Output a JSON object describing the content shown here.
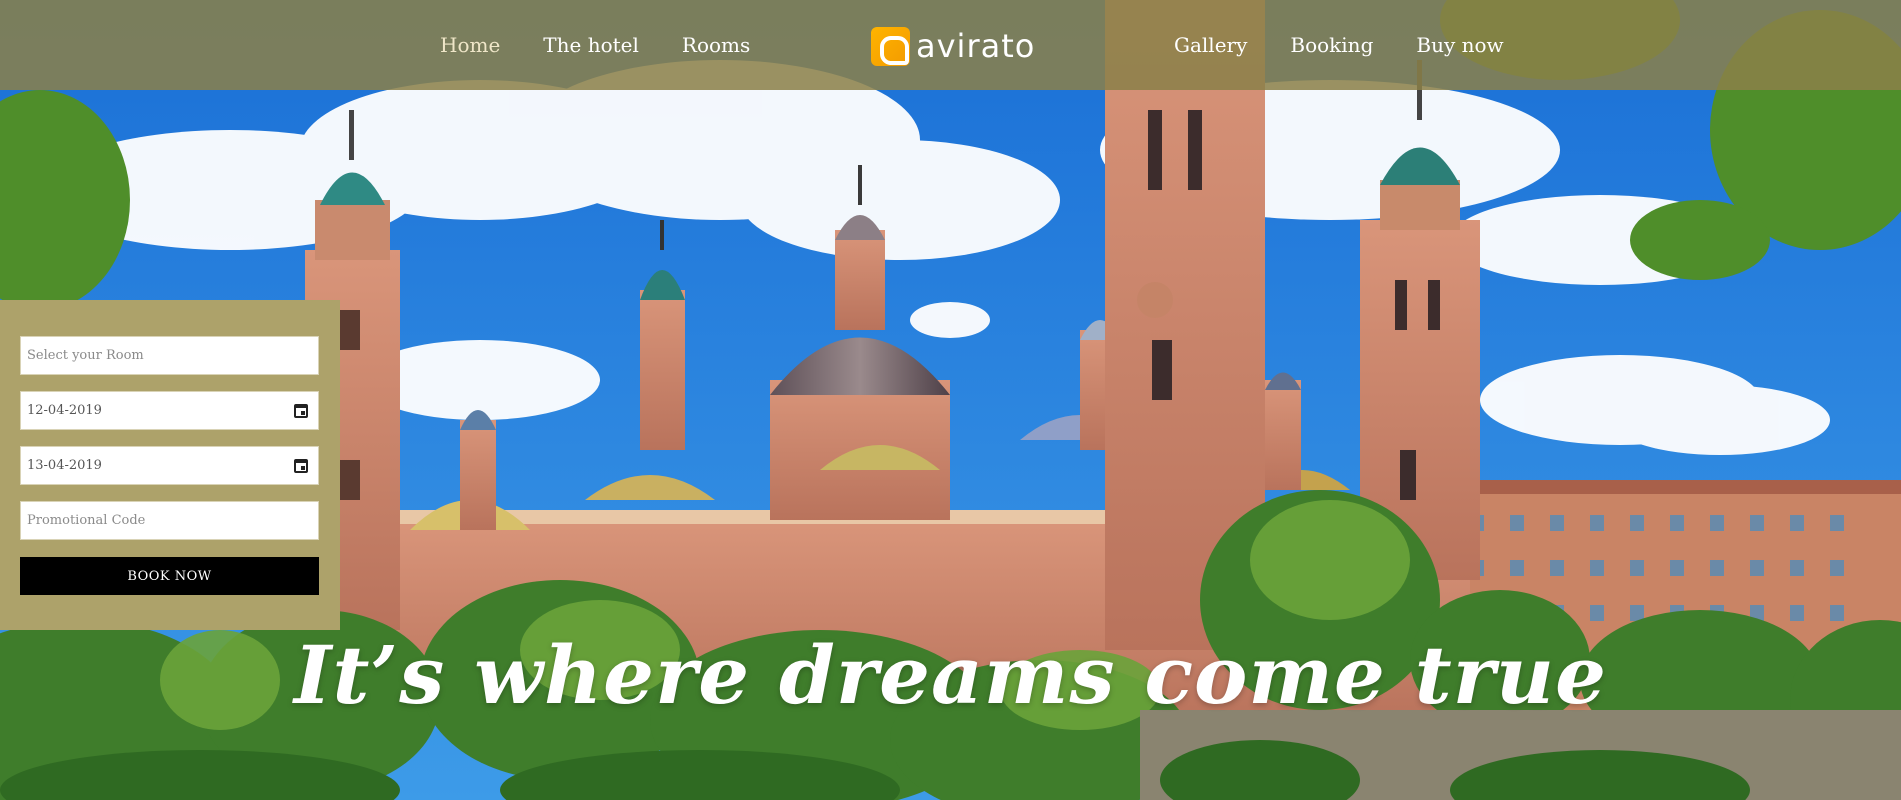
{
  "nav": {
    "left": [
      {
        "label": "Home",
        "active": true
      },
      {
        "label": "The hotel",
        "active": false
      },
      {
        "label": "Rooms",
        "active": false
      }
    ],
    "right": [
      {
        "label": "Gallery"
      },
      {
        "label": "Booking"
      },
      {
        "label": "Buy now"
      }
    ]
  },
  "logo": {
    "text": "avirato",
    "mark": "logo-icon",
    "color": "#ffb400"
  },
  "booking": {
    "room_placeholder": "Select your Room",
    "checkin_value": "12-04-2019",
    "checkout_value": "13-04-2019",
    "promo_placeholder": "Promotional Code",
    "button_label": "BOOK NOW"
  },
  "hero": {
    "tagline": "It’s where dreams come true"
  },
  "colors": {
    "nav_bg": "#8a8048",
    "panel_bg": "#ada26a",
    "button_bg": "#000000"
  }
}
